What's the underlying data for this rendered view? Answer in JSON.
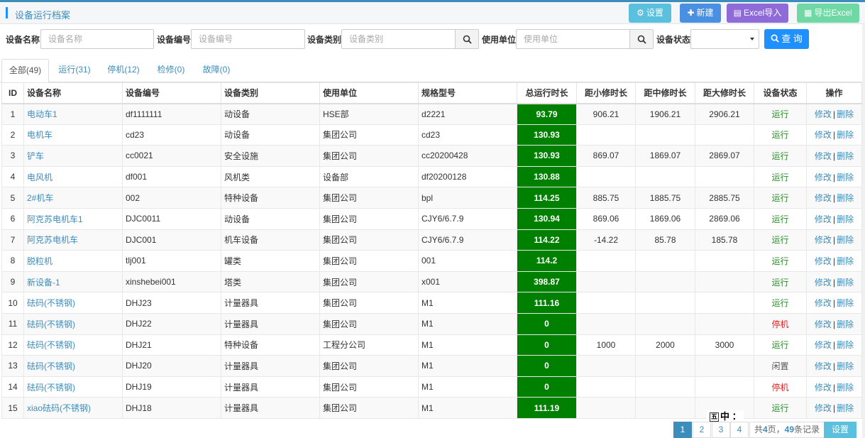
{
  "header": {
    "title": "设备运行档案",
    "buttons": {
      "settings": "设置",
      "new": "新建",
      "import": "Excel导入",
      "export": "导出Excel"
    }
  },
  "filters": {
    "name_label": "设备名称",
    "name_placeholder": "设备名称",
    "code_label": "设备编号",
    "code_placeholder": "设备编号",
    "type_label": "设备类别",
    "type_placeholder": "设备类别",
    "unit_label": "使用单位",
    "unit_placeholder": "使用单位",
    "status_label": "设备状态",
    "status_value": "",
    "query_label": "查 询"
  },
  "tabs": [
    {
      "label": "全部(49)"
    },
    {
      "label": "运行(31)"
    },
    {
      "label": "停机(12)"
    },
    {
      "label": "检修(0)"
    },
    {
      "label": "故障(0)"
    }
  ],
  "table": {
    "headers": [
      "ID",
      "设备名称",
      "设备编号",
      "设备类别",
      "使用单位",
      "规格型号",
      "总运行时长",
      "距小修时长",
      "距中修时长",
      "距大修时长",
      "设备状态",
      "操作"
    ],
    "action_edit": "修改",
    "action_sep": "|",
    "action_delete": "删除",
    "rows": [
      {
        "id": "1",
        "name": "电动车1",
        "code": "df1111111",
        "type": "动设备",
        "unit": "HSE部",
        "model": "d2221",
        "total": "93.79",
        "minor": "906.21",
        "medium": "1906.21",
        "major": "2906.21",
        "status": "运行"
      },
      {
        "id": "2",
        "name": "电机车",
        "code": "cd23",
        "type": "动设备",
        "unit": "集团公司",
        "model": "cd23",
        "total": "130.93",
        "minor": "",
        "medium": "",
        "major": "",
        "status": "运行"
      },
      {
        "id": "3",
        "name": "铲车",
        "code": "cc0021",
        "type": "安全设施",
        "unit": "集团公司",
        "model": "cc20200428",
        "total": "130.93",
        "minor": "869.07",
        "medium": "1869.07",
        "major": "2869.07",
        "status": "运行"
      },
      {
        "id": "4",
        "name": "电风机",
        "code": "df001",
        "type": "风机类",
        "unit": "设备部",
        "model": "df20200128",
        "total": "130.88",
        "minor": "",
        "medium": "",
        "major": "",
        "status": "运行"
      },
      {
        "id": "5",
        "name": "2#机车",
        "code": "002",
        "type": "特种设备",
        "unit": "集团公司",
        "model": "bpl",
        "total": "114.25",
        "minor": "885.75",
        "medium": "1885.75",
        "major": "2885.75",
        "status": "运行"
      },
      {
        "id": "6",
        "name": "阿克苏电机车1",
        "code": "DJC0011",
        "type": "动设备",
        "unit": "集团公司",
        "model": "CJY6/6.7.9",
        "total": "130.94",
        "minor": "869.06",
        "medium": "1869.06",
        "major": "2869.06",
        "status": "运行"
      },
      {
        "id": "7",
        "name": "阿克苏电机车",
        "code": "DJC001",
        "type": "机车设备",
        "unit": "集团公司",
        "model": "CJY6/6.7.9",
        "total": "114.22",
        "minor": "-14.22",
        "medium": "85.78",
        "major": "185.78",
        "status": "运行"
      },
      {
        "id": "8",
        "name": "脱粒机",
        "code": "tlj001",
        "type": "罐类",
        "unit": "集团公司",
        "model": "001",
        "total": "114.2",
        "minor": "",
        "medium": "",
        "major": "",
        "status": "运行"
      },
      {
        "id": "9",
        "name": "新设备-1",
        "code": "xinshebei001",
        "type": "塔类",
        "unit": "集团公司",
        "model": "x001",
        "total": "398.87",
        "minor": "",
        "medium": "",
        "major": "",
        "status": "运行"
      },
      {
        "id": "10",
        "name": "砝码(不锈钢)",
        "code": "DHJ23",
        "type": "计量器具",
        "unit": "集团公司",
        "model": "M1",
        "total": "111.16",
        "minor": "",
        "medium": "",
        "major": "",
        "status": "运行"
      },
      {
        "id": "11",
        "name": "砝码(不锈钢)",
        "code": "DHJ22",
        "type": "计量器具",
        "unit": "集团公司",
        "model": "M1",
        "total": "0",
        "minor": "",
        "medium": "",
        "major": "",
        "status": "停机"
      },
      {
        "id": "12",
        "name": "砝码(不锈钢)",
        "code": "DHJ21",
        "type": "特种设备",
        "unit": "工程分公司",
        "model": "M1",
        "total": "0",
        "minor": "1000",
        "medium": "2000",
        "major": "3000",
        "status": "运行"
      },
      {
        "id": "13",
        "name": "砝码(不锈钢)",
        "code": "DHJ20",
        "type": "计量器具",
        "unit": "集团公司",
        "model": "M1",
        "total": "0",
        "minor": "",
        "medium": "",
        "major": "",
        "status": "闲置"
      },
      {
        "id": "14",
        "name": "砝码(不锈钢)",
        "code": "DHJ19",
        "type": "计量器具",
        "unit": "集团公司",
        "model": "M1",
        "total": "0",
        "minor": "",
        "medium": "",
        "major": "",
        "status": "停机"
      },
      {
        "id": "15",
        "name": "xiao砝码(不锈钢)",
        "code": "DHJ18",
        "type": "计量器具",
        "unit": "集团公司",
        "model": "M1",
        "total": "111.19",
        "minor": "",
        "medium": "",
        "major": "",
        "status": "运行"
      }
    ]
  },
  "pagination": {
    "pages": [
      "1",
      "2",
      "3",
      "4"
    ],
    "current": "1",
    "info_prefix": "共",
    "total_pages": "4",
    "info_mid": "页，",
    "total_records": "49",
    "info_suffix": "条记录",
    "settings_label": "设置"
  },
  "ime": {
    "box_glyph": "五",
    "mode": "中",
    "punct": "："
  },
  "colors": {
    "accent": "#3c8dbc",
    "total_bg": "#008000",
    "status_run": "#2e8b2e",
    "status_stop": "#e02020"
  }
}
